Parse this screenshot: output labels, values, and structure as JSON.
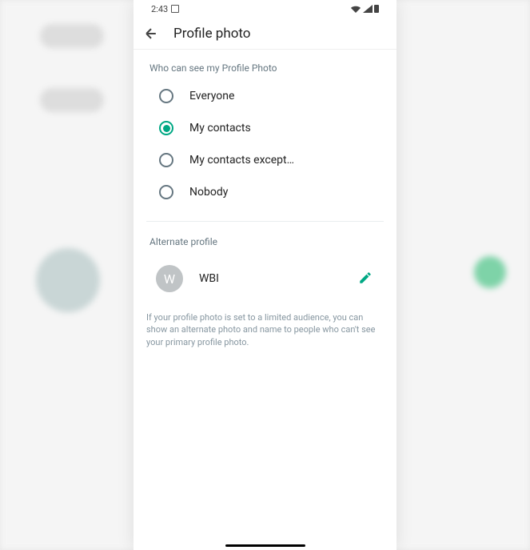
{
  "status": {
    "time": "2:43"
  },
  "header": {
    "title": "Profile photo"
  },
  "privacy": {
    "section_title": "Who can see my Profile Photo",
    "options": [
      {
        "label": "Everyone",
        "selected": false
      },
      {
        "label": "My contacts",
        "selected": true
      },
      {
        "label": "My contacts except…",
        "selected": false
      },
      {
        "label": "Nobody",
        "selected": false
      }
    ]
  },
  "alternate": {
    "section_title": "Alternate profile",
    "avatar_initial": "W",
    "name": "WBI",
    "help": "If your profile photo is set to a limited audience, you can show an alternate photo and name to people who can't see your primary profile photo."
  }
}
